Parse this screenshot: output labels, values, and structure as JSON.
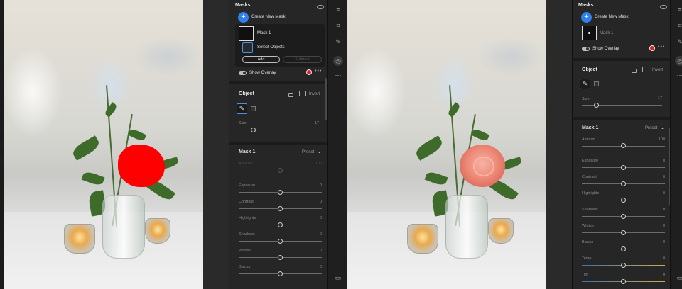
{
  "left": {
    "panel_title": "Masks",
    "create_label": "Create New Mask",
    "mask_name": "Mask 1",
    "select_objects": "Select Objects",
    "add_label": "Add",
    "subtract_label": "Subtract",
    "show_overlay": "Show Overlay",
    "object_title": "Object",
    "invert_label": "Invert",
    "size_label": "Size",
    "size_value": "17",
    "mask_section": "Mask 1",
    "preset_label": "Preset",
    "amount_label": "Amount",
    "amount_value": "100",
    "sliders": [
      {
        "label": "Exposure",
        "value": "0"
      },
      {
        "label": "Contrast",
        "value": "0"
      },
      {
        "label": "Highlights",
        "value": "0"
      },
      {
        "label": "Shadows",
        "value": "0"
      },
      {
        "label": "Whites",
        "value": "0"
      },
      {
        "label": "Blacks",
        "value": "0"
      }
    ]
  },
  "right": {
    "panel_title": "Masks",
    "create_label": "Create New Mask",
    "mask_name": "Mask 1",
    "show_overlay": "Show Overlay",
    "object_title": "Object",
    "invert_label": "Invert",
    "size_label": "Size",
    "size_value": "17",
    "mask_section": "Mask 1",
    "preset_label": "Preset",
    "amount_label": "Amount",
    "amount_value": "100",
    "sliders": [
      {
        "label": "Exposure",
        "value": "0"
      },
      {
        "label": "Contrast",
        "value": "0"
      },
      {
        "label": "Highlights",
        "value": "0"
      },
      {
        "label": "Shadows",
        "value": "0"
      },
      {
        "label": "Whites",
        "value": "0"
      },
      {
        "label": "Blacks",
        "value": "0"
      },
      {
        "label": "Temp",
        "value": "0"
      },
      {
        "label": "Tint",
        "value": "0"
      }
    ]
  },
  "icons": {
    "mask_overlay_color": "#e0201c",
    "accent": "#2f80ed"
  }
}
